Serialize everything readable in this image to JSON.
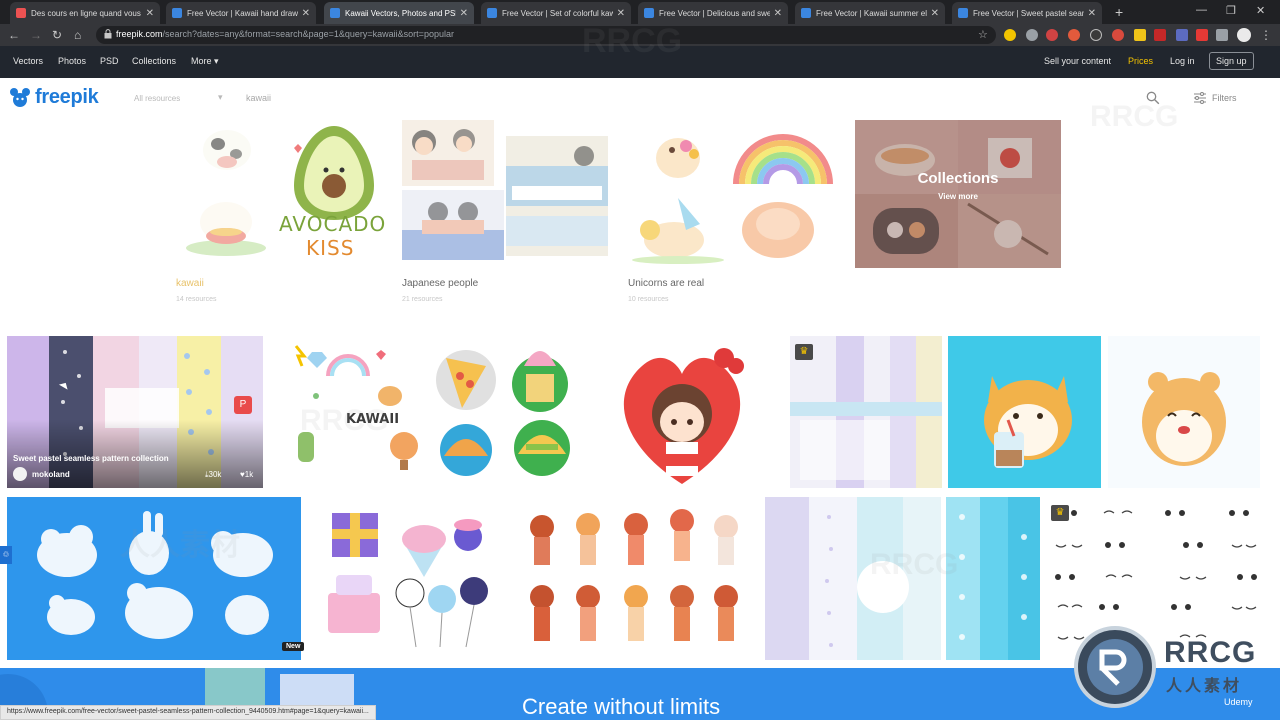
{
  "browser": {
    "tabs": [
      {
        "title": "Des cours en ligne quand vous",
        "favicon_color": "#ec5252",
        "active": false
      },
      {
        "title": "Free Vector | Kawaii hand drawn",
        "favicon_color": "#3b86e0",
        "active": false
      },
      {
        "title": "Kawaii Vectors, Photos and PSD",
        "favicon_color": "#3b86e0",
        "active": true
      },
      {
        "title": "Free Vector | Set of colorful kaw",
        "favicon_color": "#3b86e0",
        "active": false
      },
      {
        "title": "Free Vector | Delicious and swe",
        "favicon_color": "#3b86e0",
        "active": false
      },
      {
        "title": "Free Vector | Kawaii summer ele",
        "favicon_color": "#3b86e0",
        "active": false
      },
      {
        "title": "Free Vector | Sweet pastel seaml",
        "favicon_color": "#3b86e0",
        "active": false
      }
    ],
    "url_host": "freepik.com",
    "url_path": "/search?dates=any&format=search&page=1&query=kawaii&sort=popular",
    "status_url": "https://www.freepik.com/free-vector/sweet-pastel-seamless-pattern-collection_9440509.htm#page=1&query=kawaii..."
  },
  "topnav": {
    "vectors": "Vectors",
    "photos": "Photos",
    "psd": "PSD",
    "collections": "Collections",
    "more": "More ▾",
    "sell": "Sell your content",
    "prices": "Prices",
    "login": "Log in",
    "signup": "Sign up"
  },
  "header": {
    "logo": "freepik",
    "resources": "All resources",
    "query": "kawaii",
    "filters": "Filters"
  },
  "collections_row": {
    "cards": [
      {
        "title": "kawaii",
        "sub": "14 resources"
      },
      {
        "title": "Japanese people",
        "sub": "21 resources"
      },
      {
        "title": "Unicorns are real",
        "sub": "10 resources"
      }
    ],
    "collections_tile": {
      "title": "Collections",
      "more": "View more"
    },
    "avocado_top": "AVOCADO",
    "avocado_bottom": "KISS"
  },
  "grid": {
    "hovered": {
      "title": "Sweet pastel seamless pattern collection",
      "author": "mokoland",
      "downloads": "⤓30k",
      "likes": "♥1k"
    },
    "kawaii_label": "KAWAII",
    "new_badge": "New"
  },
  "banner": {
    "title": "Create without limits",
    "udemy": "Udemy"
  },
  "watermark": {
    "name": "RRCG",
    "sub": "人人素材"
  },
  "colors": {
    "brand": "#1f7bd8",
    "prices": "#f3c200",
    "banner": "#2f8cea",
    "nav": "#21262e"
  }
}
